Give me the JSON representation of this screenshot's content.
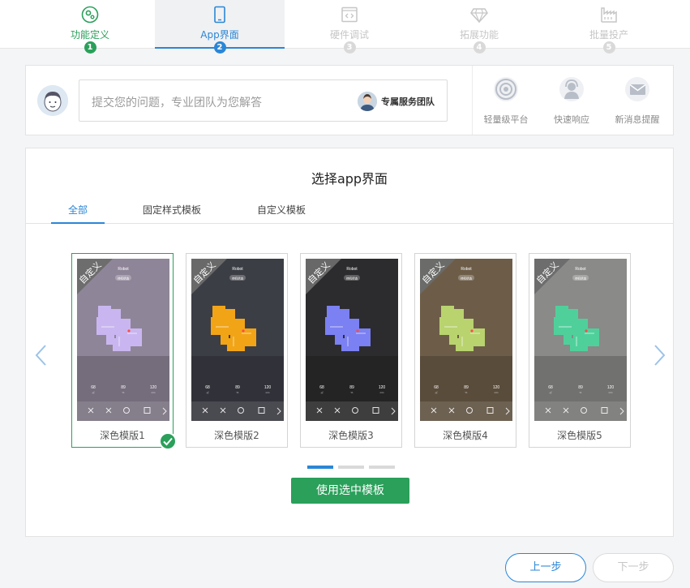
{
  "stepper": {
    "steps": [
      {
        "label": "功能定义",
        "num": "1",
        "icon": "gear-circle-icon",
        "state": "done"
      },
      {
        "label": "App界面",
        "num": "2",
        "icon": "phone-icon",
        "state": "active"
      },
      {
        "label": "硬件调试",
        "num": "3",
        "icon": "code-window-icon",
        "state": "todo"
      },
      {
        "label": "拓展功能",
        "num": "4",
        "icon": "diamond-icon",
        "state": "todo"
      },
      {
        "label": "批量投产",
        "num": "5",
        "icon": "factory-icon",
        "state": "todo"
      }
    ]
  },
  "question": {
    "placeholder": "提交您的问题，专业团队为您解答",
    "team_label": "专属服务团队",
    "features": [
      {
        "label": "轻量级平台",
        "icon": "target-icon"
      },
      {
        "label": "快速响应",
        "icon": "support-agent-icon"
      },
      {
        "label": "新消息提醒",
        "icon": "envelope-icon"
      }
    ]
  },
  "main": {
    "title": "选择app界面",
    "tabs": [
      "全部",
      "固定样式模板",
      "自定义模板"
    ],
    "active_tab": 0,
    "use_button": "使用选中模板"
  },
  "templates": [
    {
      "name": "深色模版1",
      "badge": "自定义",
      "map_color": "#c9b6f0",
      "bg": "#8f8598",
      "selected": true
    },
    {
      "name": "深色模版2",
      "badge": "自定义",
      "map_color": "#f2a417",
      "bg": "#3c3e46",
      "selected": false
    },
    {
      "name": "深色模版3",
      "badge": "自定义",
      "map_color": "#7b80f2",
      "bg": "#2c2c2e",
      "selected": false
    },
    {
      "name": "深色模版4",
      "badge": "自定义",
      "map_color": "#b9d36e",
      "bg": "#6d5d48",
      "selected": false
    },
    {
      "name": "深色模版5",
      "badge": "自定义",
      "map_color": "#4fd09b",
      "bg": "#8a8a88",
      "selected": false
    }
  ],
  "phone_ui": {
    "title": "Robot",
    "status": "待机状态",
    "stats": [
      "68",
      "89",
      "120"
    ],
    "stat_units": [
      "㎡",
      "%",
      "min"
    ]
  },
  "pager": {
    "pages": 3,
    "current": 0
  },
  "nav": {
    "prev": "上一步",
    "next": "下一步"
  },
  "colors": {
    "primary": "#2a86d6",
    "success": "#2aa05a"
  }
}
